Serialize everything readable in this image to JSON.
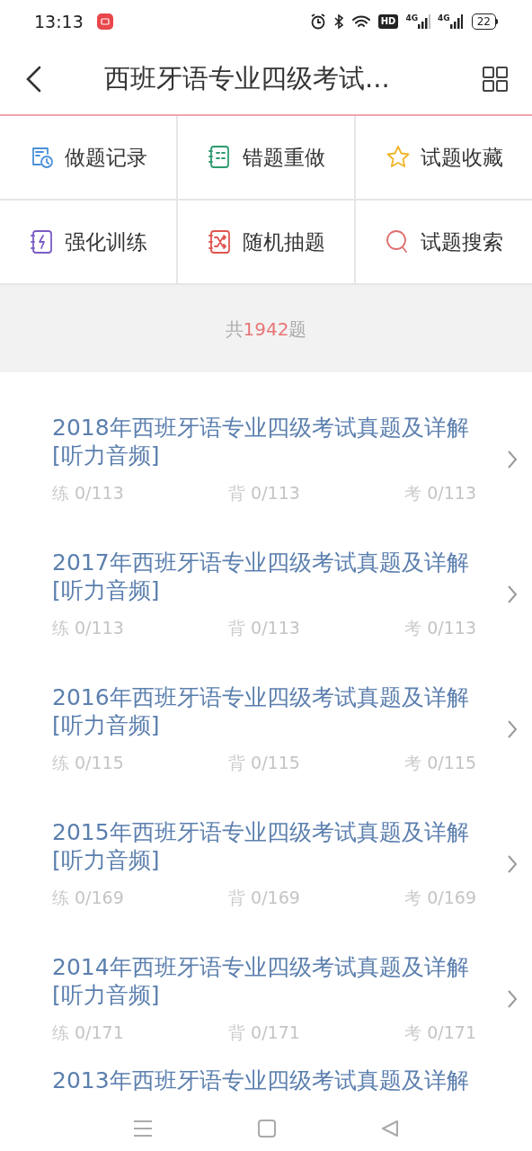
{
  "status_bar": {
    "time": "13:13",
    "hd": "HD",
    "networks": [
      "4G",
      "4G"
    ],
    "battery": "22"
  },
  "header": {
    "title": "西班牙语专业四级考试..."
  },
  "actions": [
    {
      "label": "做题记录"
    },
    {
      "label": "错题重做"
    },
    {
      "label": "试题收藏"
    },
    {
      "label": "强化训练"
    },
    {
      "label": "随机抽题"
    },
    {
      "label": "试题搜索"
    }
  ],
  "summary": {
    "prefix": "共",
    "count": "1942",
    "suffix": "题"
  },
  "items": [
    {
      "kind": "full",
      "title": "2018年西班牙语专业四级考试真题及详解[听力音频]",
      "stats": [
        {
          "label": "练",
          "value": "0/113"
        },
        {
          "label": "背",
          "value": "0/113"
        },
        {
          "label": "考",
          "value": "0/113"
        }
      ]
    },
    {
      "kind": "full",
      "title": "2017年西班牙语专业四级考试真题及详解[听力音频]",
      "stats": [
        {
          "label": "练",
          "value": "0/113"
        },
        {
          "label": "背",
          "value": "0/113"
        },
        {
          "label": "考",
          "value": "0/113"
        }
      ]
    },
    {
      "kind": "full",
      "title": "2016年西班牙语专业四级考试真题及详解[听力音频]",
      "stats": [
        {
          "label": "练",
          "value": "0/115"
        },
        {
          "label": "背",
          "value": "0/115"
        },
        {
          "label": "考",
          "value": "0/115"
        }
      ]
    },
    {
      "kind": "full",
      "title": "2015年西班牙语专业四级考试真题及详解[听力音频]",
      "stats": [
        {
          "label": "练",
          "value": "0/169"
        },
        {
          "label": "背",
          "value": "0/169"
        },
        {
          "label": "考",
          "value": "0/169"
        }
      ]
    },
    {
      "kind": "full",
      "title": "2014年西班牙语专业四级考试真题及详解[听力音频]",
      "stats": [
        {
          "label": "练",
          "value": "0/171"
        },
        {
          "label": "背",
          "value": "0/171"
        },
        {
          "label": "考",
          "value": "0/171"
        }
      ]
    },
    {
      "kind": "partial",
      "title": "2013年西班牙语专业四级考试真题及详解"
    }
  ]
}
